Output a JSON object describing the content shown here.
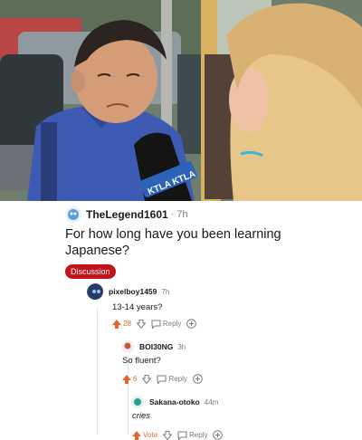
{
  "post": {
    "username": "TheLegend1601",
    "separator": "·",
    "time": "7h",
    "title": "For how long have you been learning Japanese?",
    "flair": "Discussion"
  },
  "photo": {
    "mic_brand": "KTLA KTLA"
  },
  "comments": [
    {
      "username": "pixelboy1459",
      "time": "7h",
      "body": "13-14 years?",
      "votes": "28",
      "reply_label": "Reply"
    },
    {
      "username": "BOI30NG",
      "time": "3h",
      "body": "So fluent?",
      "votes": "6",
      "reply_label": "Reply"
    },
    {
      "username": "Sakana-otoko",
      "time": "44m",
      "body": "cries",
      "votes": "Vote",
      "reply_label": "Reply"
    }
  ],
  "colors": {
    "upvote": "#e0662b",
    "flair": "#c5131a",
    "text": "#1a1a1b",
    "muted": "#7c7c7c"
  },
  "icons": [
    "upvote-icon",
    "downvote-icon",
    "reply-bubble-icon",
    "add-award-icon"
  ]
}
